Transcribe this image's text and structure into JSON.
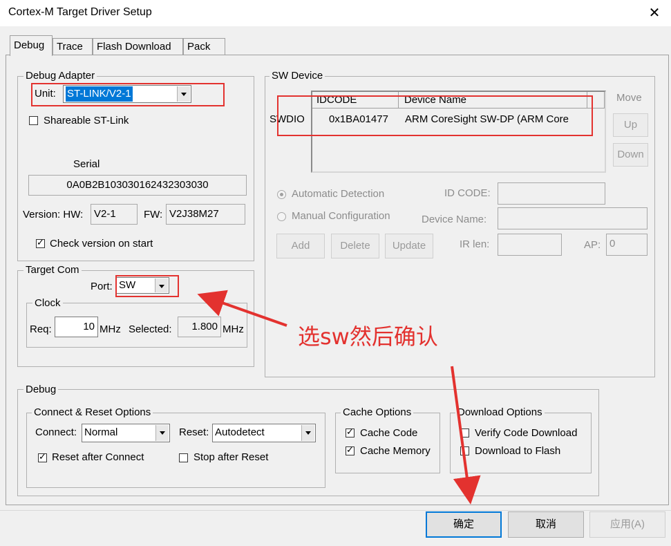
{
  "window": {
    "title": "Cortex-M Target Driver Setup",
    "close_glyph": "✕"
  },
  "tabs": [
    "Debug",
    "Trace",
    "Flash Download",
    "Pack"
  ],
  "debug_adapter": {
    "legend": "Debug Adapter",
    "unit_label": "Unit:",
    "unit_value": "ST-LINK/V2-1",
    "shareable_label": "Shareable ST-Link",
    "serial_label": "Serial",
    "serial_value": "0A0B2B103030162432303030",
    "version_label": "Version: HW:",
    "hw_value": "V2-1",
    "fw_label": "FW:",
    "fw_value": "V2J38M27",
    "check_version_label": "Check version on start"
  },
  "target_com": {
    "legend": "Target Com",
    "port_label": "Port:",
    "port_value": "SW",
    "clock_legend": "Clock",
    "req_label": "Req:",
    "req_value": "10",
    "mhz1": "MHz",
    "selected_label": "Selected:",
    "selected_value": "1.800",
    "mhz2": "MHz"
  },
  "sw_device": {
    "legend": "SW Device",
    "col_idcode": "IDCODE",
    "col_device": "Device Name",
    "row_label": "SWDIO",
    "row_idcode": "0x1BA01477",
    "row_device": "ARM CoreSight SW-DP (ARM Core",
    "move_label": "Move",
    "up_label": "Up",
    "down_label": "Down",
    "auto_label": "Automatic Detection",
    "manual_label": "Manual Configuration",
    "idcode_label": "ID CODE:",
    "devname_label": "Device Name:",
    "add_label": "Add",
    "delete_label": "Delete",
    "update_label": "Update",
    "irlen_label": "IR len:",
    "ap_label": "AP:",
    "ap_value": "0"
  },
  "debug": {
    "legend": "Debug",
    "connect_reset_legend": "Connect & Reset Options",
    "connect_label": "Connect:",
    "connect_value": "Normal",
    "reset_label": "Reset:",
    "reset_value": "Autodetect",
    "reset_after_connect": "Reset after Connect",
    "stop_after_reset": "Stop after Reset",
    "cache_legend": "Cache Options",
    "cache_code": "Cache Code",
    "cache_memory": "Cache Memory",
    "download_legend": "Download Options",
    "verify_code": "Verify Code Download",
    "download_flash": "Download to Flash"
  },
  "buttons": {
    "ok": "确定",
    "cancel": "取消",
    "apply": "应用(A)"
  },
  "annotation": {
    "text": "选sw然后确认",
    "color": "#e3322f"
  }
}
